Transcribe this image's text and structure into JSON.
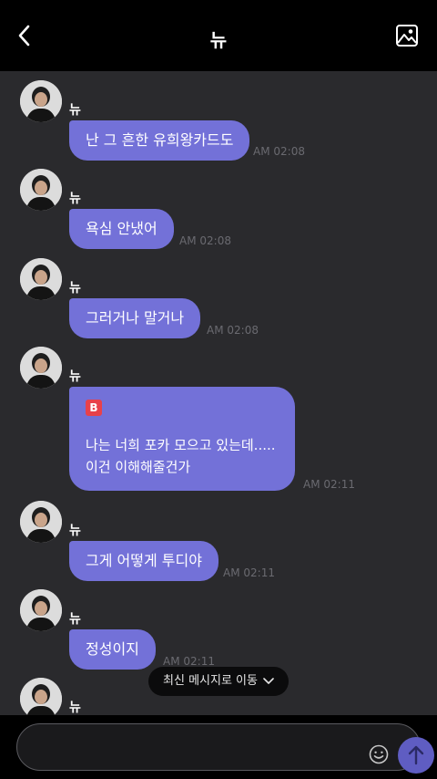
{
  "header": {
    "title": "뉴"
  },
  "messages": [
    {
      "sender": "뉴",
      "text": "난 그 흔한 유희왕카드도",
      "time": "AM 02:08"
    },
    {
      "sender": "뉴",
      "text": "욕심 안냈어",
      "time": "AM 02:08"
    },
    {
      "sender": "뉴",
      "text": "그러거나 말거나",
      "time": "AM 02:08"
    },
    {
      "sender": "뉴",
      "sticker": "B",
      "line1": "나는 너희 포카 모으고 있는데.....",
      "line2": "이건 이해해줄건가",
      "time": "AM 02:11"
    },
    {
      "sender": "뉴",
      "text": "그게 어떻게 투디야",
      "time": "AM 02:11"
    },
    {
      "sender": "뉴",
      "text": "정성이지",
      "time": "AM 02:11"
    },
    {
      "sender": "뉴"
    }
  ],
  "jump_button": {
    "label": "최신 메시지로 이동"
  },
  "composer": {
    "placeholder": ""
  },
  "colors": {
    "bubble": "#7371d8",
    "send": "#5f5dc2",
    "background": "#2a2a2d"
  }
}
